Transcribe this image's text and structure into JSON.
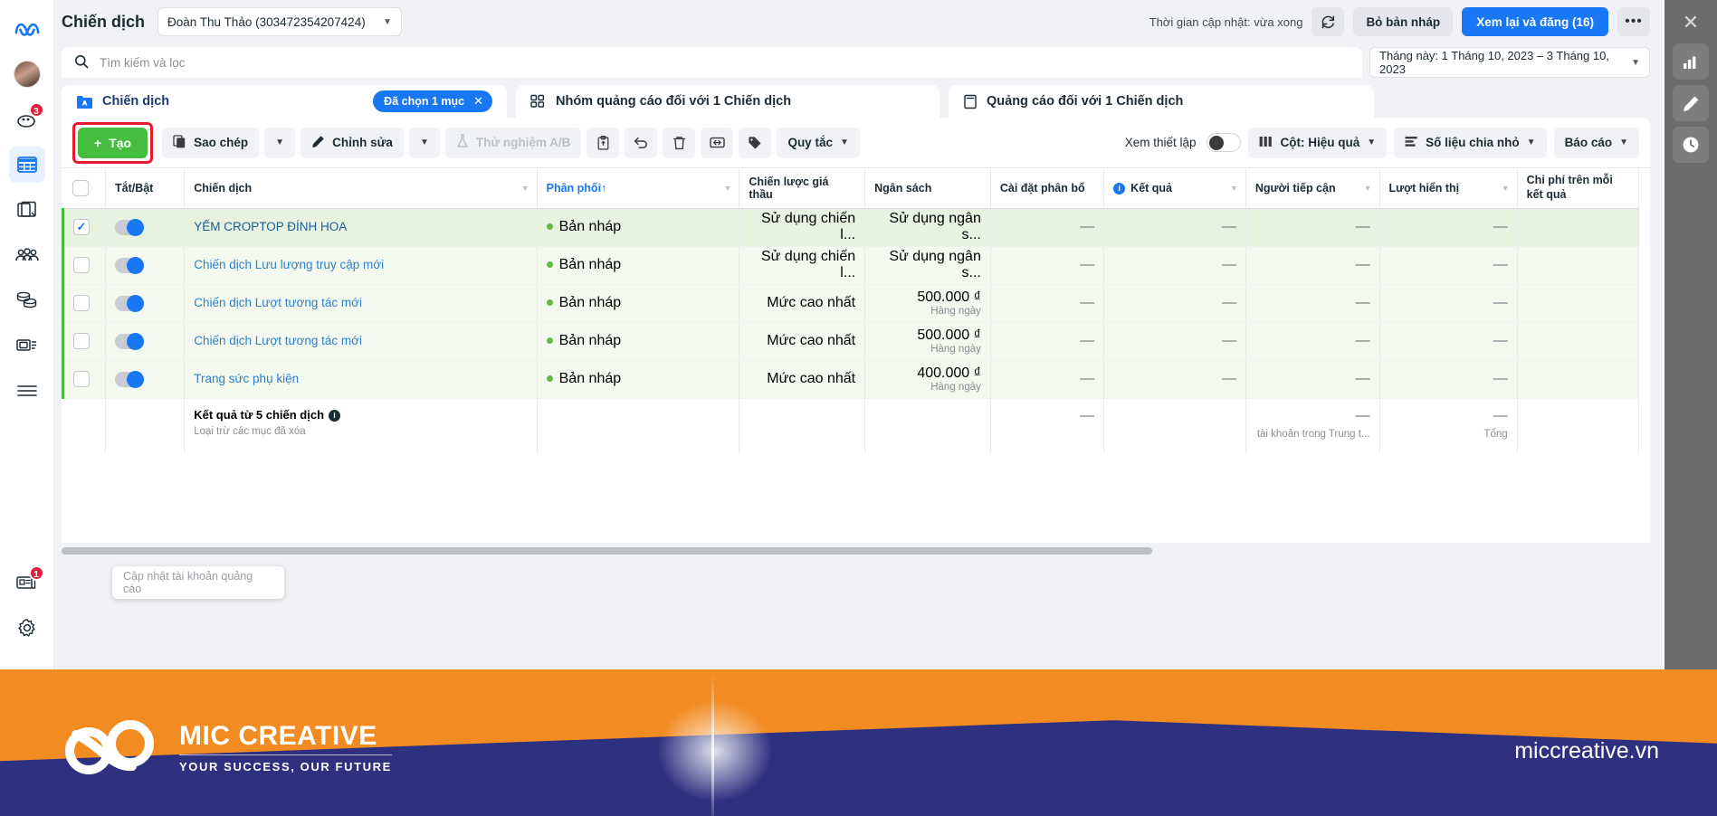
{
  "header": {
    "title": "Chiến dịch",
    "account_select": "Đoàn Thu Thảo (303472354207424)",
    "update_time": "Thời gian cập nhật: vừa xong",
    "refresh_icon": "refresh-icon",
    "discard_label": "Bỏ bản nháp",
    "publish_label": "Xem lại và đăng (16)",
    "more_label": "•••",
    "close_label": "✕"
  },
  "search": {
    "placeholder": "Tìm kiếm và lọc",
    "icon": "search-icon",
    "date_range": "Tháng này: 1 Tháng 10, 2023 – 3 Tháng 10, 2023"
  },
  "tabs": [
    {
      "label": "Chiến dịch",
      "icon": "campaign-folder-icon",
      "chip": "Đã chọn 1 mục",
      "chip_close": "✕"
    },
    {
      "label": "Nhóm quảng cáo đối với 1 Chiến dịch",
      "icon": "adset-grid-icon"
    },
    {
      "label": "Quảng cáo đối với 1 Chiến dịch",
      "icon": "ad-page-icon"
    }
  ],
  "toolbar": {
    "create_label": "Tạo",
    "create_plus": "+",
    "duplicate_label": "Sao chép",
    "edit_label": "Chỉnh sửa",
    "abtest_label": "Thử nghiệm A/B",
    "rules_label": "Quy tắc",
    "view_setup_label": "Xem thiết lập",
    "columns_label": "Cột: Hiệu quả",
    "breakdown_label": "Số liệu chia nhỏ",
    "reports_label": "Báo cáo",
    "icons": {
      "duplicate": "copy-icon",
      "edit": "pencil-icon",
      "abtest": "flask-icon",
      "clipboard": "clipboard-icon",
      "undo": "undo-icon",
      "delete": "trash-icon",
      "export": "export-icon",
      "tag": "tag-icon",
      "columns": "columns-icon",
      "breakdown": "breakdown-icon"
    }
  },
  "table": {
    "columns": [
      {
        "key": "check",
        "label": ""
      },
      {
        "key": "toggle",
        "label": "Tắt/Bật"
      },
      {
        "key": "campaign",
        "label": "Chiến dịch",
        "sortable": true
      },
      {
        "key": "delivery",
        "label": "Phân phối",
        "sort_arrow": "↑",
        "sorted": true,
        "sortable": true
      },
      {
        "key": "bid",
        "label": "Chiến lược giá thầu"
      },
      {
        "key": "budget",
        "label": "Ngân sách"
      },
      {
        "key": "attribution",
        "label": "Cài đặt phân bổ"
      },
      {
        "key": "results",
        "label": "Kết quả",
        "info": true,
        "sortable": true
      },
      {
        "key": "reach",
        "label": "Người tiếp cận",
        "sortable": true
      },
      {
        "key": "impressions",
        "label": "Lượt hiển thị",
        "sortable": true
      },
      {
        "key": "cost_per_result",
        "label": "Chi phí trên mỗi kết quả"
      }
    ],
    "rows": [
      {
        "selected": true,
        "toggle_on": true,
        "campaign": "YẾM CROPTOP ĐÍNH HOA",
        "campaign_caps": true,
        "delivery": "Bản nháp",
        "bid": "Sử dụng chiến l...",
        "budget": "Sử dụng ngân s...",
        "budget_sub": "",
        "attribution": "—",
        "results": "—",
        "reach": "—",
        "impressions": "—",
        "cost_per_result": ""
      },
      {
        "selected": false,
        "toggle_on": true,
        "campaign": "Chiến dịch Lưu lượng truy cập mới",
        "campaign_caps": false,
        "delivery": "Bản nháp",
        "bid": "Sử dụng chiến l...",
        "budget": "Sử dụng ngân s...",
        "budget_sub": "",
        "attribution": "—",
        "results": "—",
        "reach": "—",
        "impressions": "—",
        "cost_per_result": ""
      },
      {
        "selected": false,
        "toggle_on": true,
        "campaign": "Chiến dịch Lượt tương tác mới",
        "campaign_caps": false,
        "delivery": "Bản nháp",
        "bid": "Mức cao nhất",
        "budget": "500.000 ₫",
        "budget_sub": "Hàng ngày",
        "attribution": "—",
        "results": "—",
        "reach": "—",
        "impressions": "—",
        "cost_per_result": ""
      },
      {
        "selected": false,
        "toggle_on": true,
        "campaign": "Chiến dịch Lượt tương tác mới",
        "campaign_caps": false,
        "delivery": "Bản nháp",
        "bid": "Mức cao nhất",
        "budget": "500.000 ₫",
        "budget_sub": "Hàng ngày",
        "attribution": "—",
        "results": "—",
        "reach": "—",
        "impressions": "—",
        "cost_per_result": ""
      },
      {
        "selected": false,
        "toggle_on": true,
        "campaign": "Trang sức phụ kiện",
        "campaign_caps": false,
        "delivery": "Bản nháp",
        "bid": "Mức cao nhất",
        "budget": "400.000 ₫",
        "budget_sub": "Hàng ngày",
        "attribution": "—",
        "results": "—",
        "reach": "—",
        "impressions": "—",
        "cost_per_result": ""
      }
    ],
    "totals": {
      "title": "Kết quả từ 5 chiến dịch",
      "subtitle": "Loại trừ các mục đã xóa",
      "attribution": "—",
      "results": "",
      "reach": "—",
      "reach_sub": "tài khoản trong Trung t...",
      "impressions": "—",
      "impressions_sub": "Tổng",
      "cost_per_result": ""
    }
  },
  "tooltip": {
    "text": "Cập nhật tài khoản quảng cáo"
  },
  "left_rail": {
    "logo": "meta-infinity-logo",
    "items": [
      {
        "name": "avatar",
        "badge": ""
      },
      {
        "name": "notifications-icon",
        "badge": "3"
      },
      {
        "name": "table-grid-icon",
        "badge": "",
        "active": true
      },
      {
        "name": "pages-icon",
        "badge": ""
      },
      {
        "name": "audience-icon",
        "badge": ""
      },
      {
        "name": "billing-icon",
        "badge": ""
      },
      {
        "name": "media-icon",
        "badge": ""
      },
      {
        "name": "menu-icon",
        "badge": ""
      }
    ],
    "bottom_items": [
      {
        "name": "news-icon",
        "badge": "1"
      },
      {
        "name": "gear-icon",
        "badge": ""
      }
    ]
  },
  "right_rail": {
    "close": "✕",
    "items": [
      {
        "name": "chart-bars-icon"
      },
      {
        "name": "pencil-icon"
      },
      {
        "name": "clock-icon"
      }
    ]
  },
  "banner": {
    "brand_name": "MIC CREATIVE",
    "tagline": "YOUR SUCCESS, OUR FUTURE",
    "website": "miccreative.vn",
    "logo": "mic-infinity-logo"
  },
  "colors": {
    "accent_blue": "#1877f2",
    "create_green": "#45bd3e",
    "highlight_red": "#e8192c",
    "banner_navy": "#2e3180",
    "banner_orange": "#f28b22"
  }
}
